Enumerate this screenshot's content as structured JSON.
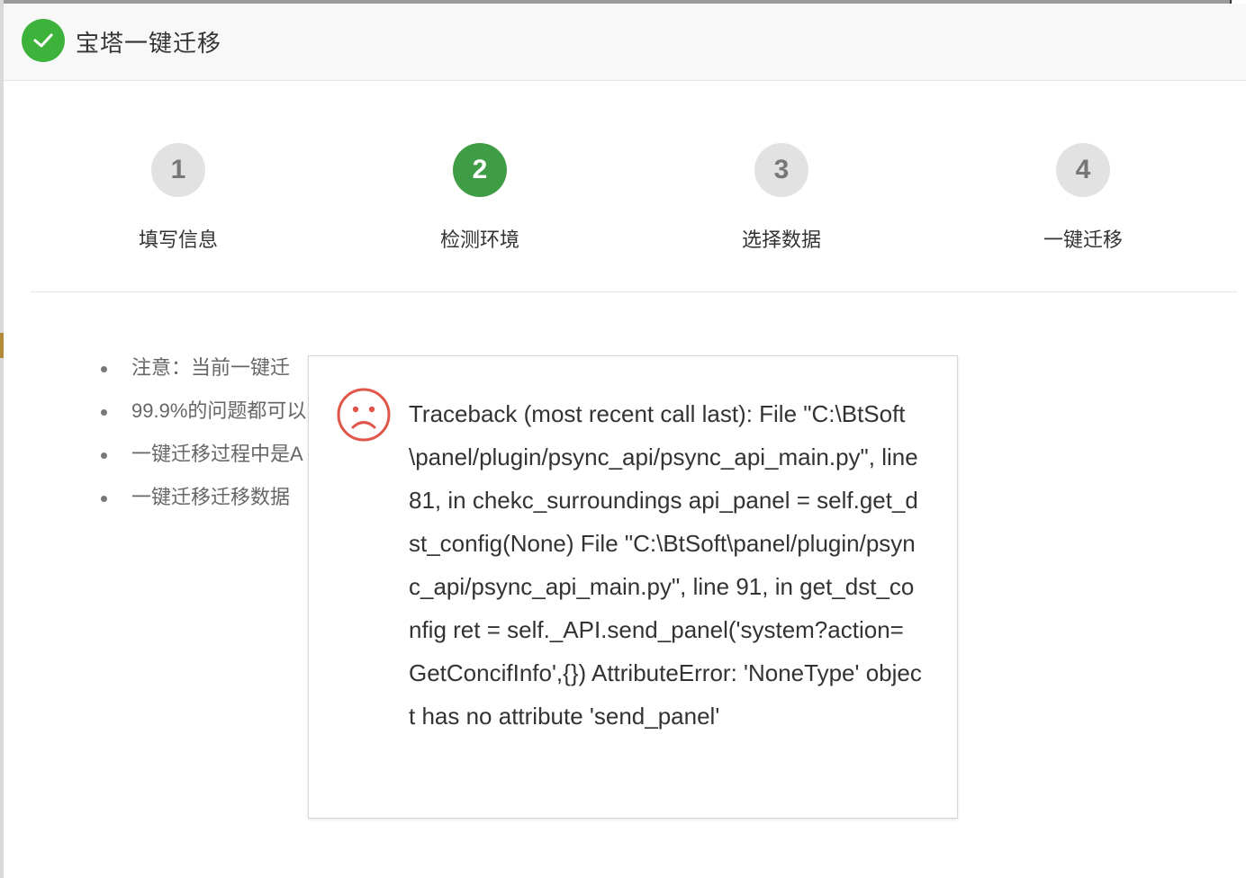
{
  "dialog": {
    "title": "宝塔一键迁移",
    "header_icon": "check-circle-icon",
    "accent": "#3db33c"
  },
  "steps": [
    {
      "number": "1",
      "label": "填写信息",
      "active": false
    },
    {
      "number": "2",
      "label": "检测环境",
      "active": true
    },
    {
      "number": "3",
      "label": "选择数据",
      "active": false
    },
    {
      "number": "4",
      "label": "一键迁移",
      "active": false
    }
  ],
  "notes": [
    "注意：当前一键迁",
    "99.9%的问题都可以",
    "一键迁移过程中是A",
    "一键迁移迁移数据"
  ],
  "error": {
    "icon": "sad-face-icon",
    "icon_color": "#e0564a",
    "message": "Traceback (most recent call last): File \"C:\\BtSoft\\panel/plugin/psync_api/psync_api_main.py\", line 81, in chekc_surroundings api_panel = self.get_dst_config(None) File \"C:\\BtSoft\\panel/plugin/psync_api/psync_api_main.py\", line 91, in get_dst_config ret = self._API.send_panel('system?action=GetConcifInfo',{}) AttributeError: 'NoneType' object has no attribute 'send_panel'"
  }
}
